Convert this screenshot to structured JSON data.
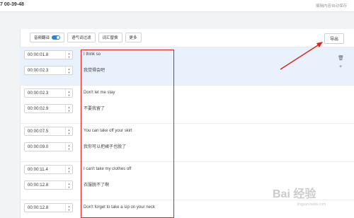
{
  "topbar": {
    "time": "7 00-39-48",
    "hint": "编辑内容自动保存"
  },
  "toolbar": {
    "smart_split": "音频翻译",
    "filter_filler": "语气词过滤",
    "replace_words": "词汇替换",
    "more": "更多"
  },
  "export_label": "导出",
  "rows": [
    {
      "start": "00:00:01.8",
      "end": "00:00:02.3",
      "en": "I think so",
      "zh": "我觉得会吧"
    },
    {
      "start": "00:00:02.3",
      "end": "00:00:02.9",
      "en": "Don't let me stay",
      "zh": "不要我留了"
    },
    {
      "start": "00:00:07.5",
      "end": "00:00:09.0",
      "en": "You can take off your skirt",
      "zh": "我你可以把裙子也脱了"
    },
    {
      "start": "00:00:11.4",
      "end": "00:00:12.8",
      "en": "I can't take my clothes off",
      "zh": "衣服脱不了啊"
    },
    {
      "start": "00:00:12.8",
      "en": "Don't forget to take a sip on your neck"
    }
  ],
  "watermark": "Bai 经验",
  "watermark_sub": "jingyan.baidu.com",
  "colors": {
    "accent": "#2f7fe8",
    "annotation": "#e02020",
    "highlight": "#e9f1fd"
  },
  "icons": {
    "delete": "trash-icon",
    "add": "plus-icon",
    "spinner": "stepper-icon"
  }
}
